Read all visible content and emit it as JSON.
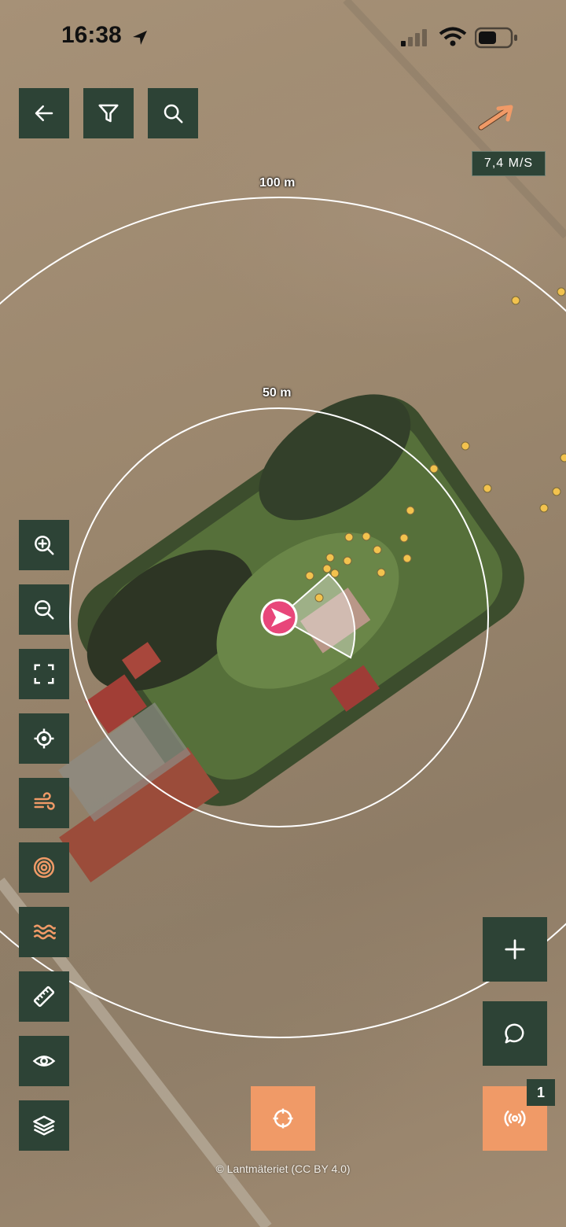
{
  "status_bar": {
    "time": "16:38"
  },
  "map": {
    "ring_outer_label": "100 m",
    "ring_inner_label": "50 m",
    "attribution": "© Lantmäteriet (CC BY 4.0)"
  },
  "wind": {
    "speed_label": "7,4 M/S",
    "arrow_icon": "wind-direction-arrow-icon",
    "arrow_color": "#f09a67"
  },
  "toolbar_top": {
    "back_icon": "arrow-left-icon",
    "filter_icon": "filter-icon",
    "search_icon": "search-icon"
  },
  "toolbar_left": {
    "items": [
      {
        "icon": "zoom-in-icon"
      },
      {
        "icon": "zoom-out-icon"
      },
      {
        "icon": "fullscreen-icon"
      },
      {
        "icon": "locate-icon"
      },
      {
        "icon": "wind-icon"
      },
      {
        "icon": "target-rings-icon"
      },
      {
        "icon": "waves-icon"
      },
      {
        "icon": "ruler-icon"
      },
      {
        "icon": "eye-icon"
      },
      {
        "icon": "layers-icon"
      }
    ]
  },
  "actions": {
    "add_icon": "plus-icon",
    "chat_icon": "chat-icon",
    "radar_icon": "broadcast-icon",
    "radar_badge": "1",
    "center_icon": "crosshair-icon"
  },
  "colors": {
    "panel": "#2d4336",
    "accent": "#f09a67",
    "marker": "#e8467a",
    "dots": "#f2c24e"
  }
}
